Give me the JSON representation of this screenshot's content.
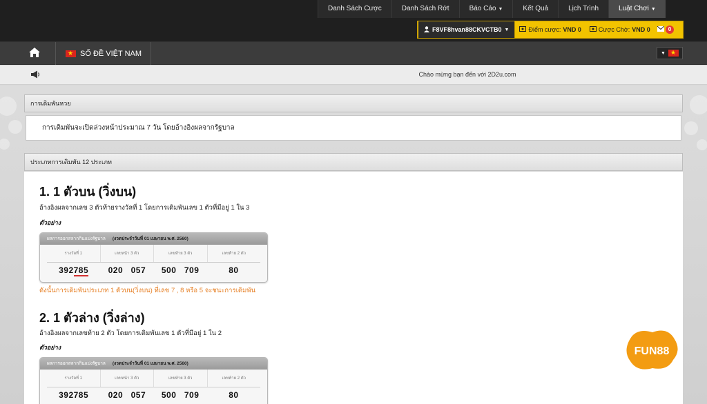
{
  "topnav": {
    "items": [
      {
        "label": "Danh Sách Cược"
      },
      {
        "label": "Danh Sách Rớt"
      },
      {
        "label": "Báo Cáo",
        "dropdown": true
      },
      {
        "label": "Kết Quả"
      },
      {
        "label": "Lịch Trình"
      },
      {
        "label": "Luật Chơi",
        "dropdown": true,
        "active": true
      }
    ]
  },
  "user": {
    "account": "F8VF8hvan88CKVCTB0",
    "bet_label": "Điểm cược:",
    "bet_value": "VND 0",
    "pending_label": "Cược Chờ:",
    "pending_value": "VND 0",
    "mail_count": "0"
  },
  "site": {
    "name": "SỐ ĐỀ VIỆT NAM"
  },
  "marquee": {
    "text": "Chào mừng bạn đến với 2D2u.com"
  },
  "panel1": {
    "title": "การเดิมพันหวย",
    "body": "การเดิมพันจะเปิดล่วงหน้าประมาณ 7 วัน โดยอ้างอิงผลจากรัฐบาล"
  },
  "panel2": {
    "title": "ประเภทการเดิมพัน 12 ประเภท",
    "sections": [
      {
        "title": "1. 1 ตัวบน (วิ่งบน)",
        "desc": "อ้างอิงผลจากเลข 3 ตัวท้ายรางวัลที่ 1 โดยการเดิมพันเลข 1 ตัวที่มีอยู่ 1 ใน 3",
        "example": "ตัวอย่าง",
        "note": "ดังนั้นการเดิมพันประเภท 1 ตัวบน(วิ่งบน) ที่เลข 7 , 8 หรือ 5 จะชนะการเดิมพัน"
      },
      {
        "title": "2. 1 ตัวล่าง (วิ่งล่าง)",
        "desc": "อ้างอิงผลจากเลขท้าย 2 ตัว โดยการเดิมพันเลข 1 ตัวที่มีอยู่ 1 ใน 2",
        "example": "ตัวอย่าง"
      }
    ]
  },
  "result_card": {
    "header": "ผลการออกสลากกินแบ่งรัฐบาล",
    "date": "(งวดประจำวันที่ 01 เมษายน พ.ศ. 2560)",
    "columns": [
      "รางวัลที่ 1",
      "เลขหน้า 3 ตัว",
      "เลขท้าย 3 ตัว",
      "เลขท้าย 2 ตัว"
    ],
    "prize1_head": "392",
    "prize1_tail": "785",
    "front3": "020   057",
    "back3": "500   709",
    "back2": "80"
  },
  "badge": {
    "text": "FUN88",
    "color": "#f39c12"
  }
}
